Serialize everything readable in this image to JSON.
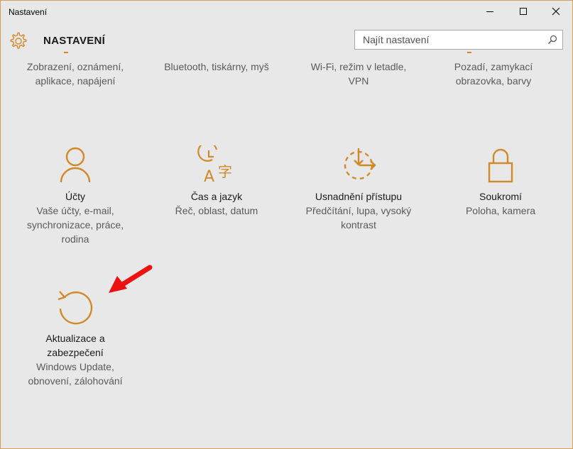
{
  "window": {
    "title": "Nastavení",
    "controls": {
      "minimize": "minimize",
      "maximize": "maximize",
      "close": "close"
    }
  },
  "header": {
    "title": "NASTAVENÍ",
    "search_placeholder": "Najít nastavení"
  },
  "colors": {
    "accent": "#d08a2a",
    "background": "#e8e8e8",
    "annotation_arrow": "#ee1111"
  },
  "top_row": [
    {
      "desc": "Zobrazení, oznámení, aplikace, napájení"
    },
    {
      "desc": "Bluetooth, tiskárny, myš"
    },
    {
      "desc": "Wi-Fi, režim v letadle, VPN"
    },
    {
      "desc": "Pozadí, zamykací obrazovka, barvy"
    }
  ],
  "tiles": [
    {
      "icon": "person-icon",
      "title": "Účty",
      "desc": "Vaše účty, e-mail, synchronizace, práce, rodina"
    },
    {
      "icon": "time-language-icon",
      "title": "Čas a jazyk",
      "desc": "Řeč, oblast, datum"
    },
    {
      "icon": "ease-of-access-icon",
      "title": "Usnadnění přístupu",
      "desc": "Předčítání, lupa, vysoký kontrast"
    },
    {
      "icon": "lock-icon",
      "title": "Soukromí",
      "desc": "Poloha, kamera"
    },
    {
      "icon": "update-icon",
      "title": "Aktualizace a zabezpečení",
      "desc": "Windows Update, obnovení, zálohování"
    }
  ]
}
